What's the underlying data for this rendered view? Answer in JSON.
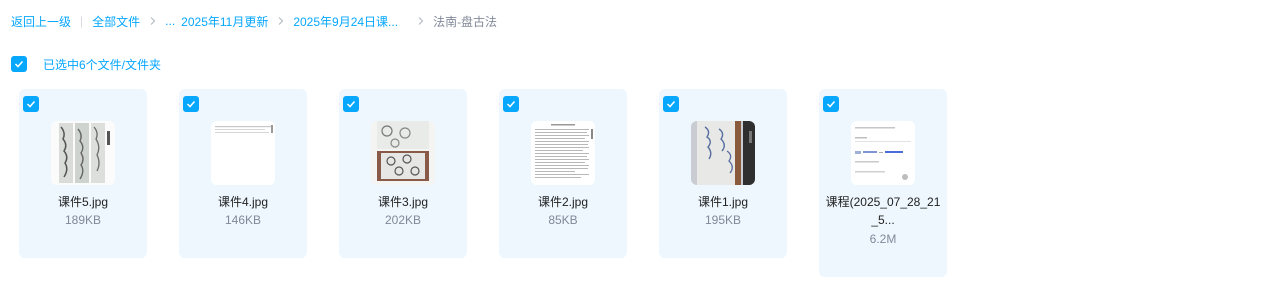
{
  "breadcrumb": {
    "back_label": "返回上一级",
    "root_label": "全部文件",
    "ellipsis": "...",
    "items": [
      "2025年11月更新",
      "2025年9月24日课..."
    ],
    "current": "法南-盘古法"
  },
  "selection": {
    "label": "已选中6个文件/文件夹"
  },
  "accent_color": "#06a7ff",
  "files": [
    {
      "name": "课件5.jpg",
      "size": "189KB",
      "thumb": "image-thumbnail"
    },
    {
      "name": "课件4.jpg",
      "size": "146KB",
      "thumb": "image-thumbnail"
    },
    {
      "name": "课件3.jpg",
      "size": "202KB",
      "thumb": "image-thumbnail"
    },
    {
      "name": "课件2.jpg",
      "size": "85KB",
      "thumb": "image-thumbnail"
    },
    {
      "name": "课件1.jpg",
      "size": "195KB",
      "thumb": "image-thumbnail"
    },
    {
      "name": "课程(2025_07_28_21_5...",
      "size": "6.2M",
      "thumb": "video-thumbnail"
    }
  ]
}
